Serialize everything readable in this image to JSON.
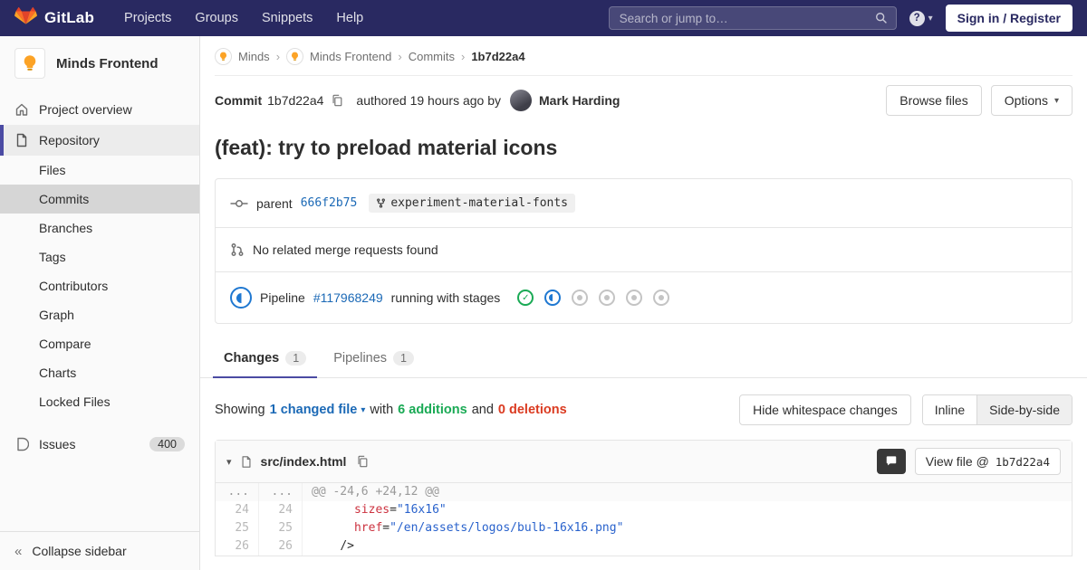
{
  "navbar": {
    "brand": "GitLab",
    "links": [
      "Projects",
      "Groups",
      "Snippets",
      "Help"
    ],
    "search_placeholder": "Search or jump to…",
    "signin": "Sign in / Register"
  },
  "sidebar": {
    "project_name": "Minds Frontend",
    "project_overview": "Project overview",
    "repository": "Repository",
    "repo_items": [
      "Files",
      "Commits",
      "Branches",
      "Tags",
      "Contributors",
      "Graph",
      "Compare",
      "Charts",
      "Locked Files"
    ],
    "issues": "Issues",
    "issues_count": "400",
    "collapse": "Collapse sidebar"
  },
  "breadcrumb": {
    "group": "Minds",
    "project": "Minds Frontend",
    "section": "Commits",
    "current": "1b7d22a4",
    "separator": "›"
  },
  "commit_bar": {
    "label": "Commit",
    "sha": "1b7d22a4",
    "authored": "authored 19 hours ago by",
    "author": "Mark Harding",
    "browse_files": "Browse files",
    "options": "Options"
  },
  "commit": {
    "title": "(feat): try to preload material icons",
    "parent_label": "parent",
    "parent_sha": "666f2b75",
    "branch": "experiment-material-fonts",
    "mr_message": "No related merge requests found",
    "pipeline_label": "Pipeline",
    "pipeline_id": "#117968249",
    "pipeline_text": "running with stages"
  },
  "tabs": {
    "changes": "Changes",
    "changes_count": "1",
    "pipelines": "Pipelines",
    "pipelines_count": "1"
  },
  "changes_bar": {
    "showing": "Showing",
    "file_dropdown": "1 changed file",
    "with_word": "with",
    "additions": "6 additions",
    "and_word": "and",
    "deletions": "0 deletions",
    "hide_whitespace": "Hide whitespace changes",
    "inline": "Inline",
    "side_by_side": "Side-by-side"
  },
  "diff": {
    "filename": "src/index.html",
    "view_file": "View file @",
    "view_sha": "1b7d22a4",
    "hunk_old": "...",
    "hunk_new": "...",
    "hunk": "@@ -24,6 +24,12 @@",
    "rows": [
      {
        "old": "24",
        "new": "24",
        "indent": "      ",
        "attr": "sizes",
        "eq": "=",
        "str": "\"16x16\"",
        "plain": ""
      },
      {
        "old": "25",
        "new": "25",
        "indent": "      ",
        "attr": "href",
        "eq": "=",
        "str": "\"/en/assets/logos/bulb-16x16.png\"",
        "plain": ""
      },
      {
        "old": "26",
        "new": "26",
        "indent": "    ",
        "attr": "",
        "eq": "",
        "str": "",
        "plain": "/>"
      }
    ]
  },
  "colors": {
    "navbar_bg": "#292961",
    "accent": "#4b4ba3",
    "link": "#1b69b6",
    "success": "#1aaa55",
    "running": "#1f78d1",
    "danger": "#db3b21"
  }
}
